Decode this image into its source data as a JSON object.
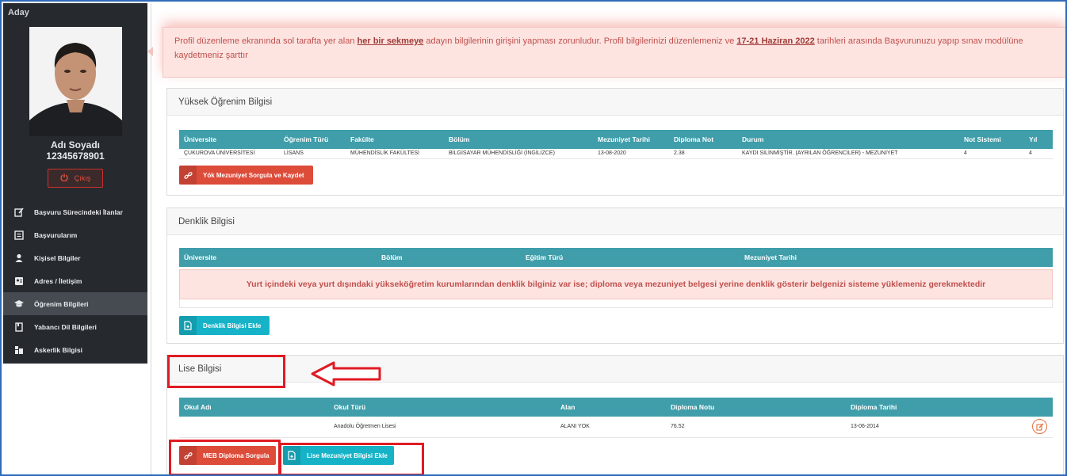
{
  "sidebar": {
    "title": "Aday",
    "name": "Adı Soyadı",
    "id_number": "12345678901",
    "logout_label": "Çıkış",
    "menu": [
      {
        "label": "Başvuru Sürecindeki İlanlar",
        "icon": "edit-icon"
      },
      {
        "label": "Başvurularım",
        "icon": "list-box-icon"
      },
      {
        "label": "Kişisel Bilgiler",
        "icon": "user-icon"
      },
      {
        "label": "Adres / İletişim",
        "icon": "address-card-icon"
      },
      {
        "label": "Öğrenim Bilgileri",
        "icon": "graduation-cap-icon"
      },
      {
        "label": "Yabancı Dil Bilgileri",
        "icon": "book-icon"
      },
      {
        "label": "Askerlik Bilgisi",
        "icon": "military-icon"
      }
    ],
    "active_index": 4
  },
  "alert": {
    "text_1": "Profil düzenleme ekranında sol tarafta yer alan ",
    "bold_1": "her bir sekmeye",
    "text_2": " adayın bilgilerinin girişini yapması zorunludur.  Profil bilgilerinizi düzenlemeniz ve ",
    "bold_2": "17-21 Haziran 2022",
    "text_3": " tarihleri arasında Başvurunuzu yapıp sınav modülüne kaydetmeniz şarttır"
  },
  "higher_education": {
    "title": "Yüksek Öğrenim Bilgisi",
    "headers": [
      "Üniversite",
      "Öğrenim Türü",
      "Fakülte",
      "Bölüm",
      "Mezuniyet Tarihi",
      "Diploma Not",
      "Durum",
      "Not Sistemi",
      "Yıl"
    ],
    "row": [
      "ÇUKUROVA ÜNİVERSİTESİ",
      "LİSANS",
      "MÜHENDİSLİK FAKÜLTESİ",
      "BİLGİSAYAR MÜHENDİSLİĞİ (İNGİLİZCE)",
      "13-08-2020",
      "2.38",
      "KAYDI SİLİNMİŞTİR. (AYRILAN ÖĞRENCİLER) - MEZUNİYET",
      "4",
      "4"
    ],
    "button_label": "Yök Mezuniyet Sorgula ve Kaydet"
  },
  "equivalence": {
    "title": "Denklik Bilgisi",
    "headers": [
      "Üniversite",
      "Bölüm",
      "Eğitim Türü",
      "Mezuniyet Tarihi"
    ],
    "notice": "Yurt içindeki veya yurt dışındaki yükseköğretim kurumlarından denklik bilginiz var ise; diploma veya mezuniyet belgesi yerine denklik gösterir belgenizi sisteme yüklemeniz gerekmektedir",
    "button_label": "Denklik Bilgisi Ekle"
  },
  "high_school": {
    "title": "Lise Bilgisi",
    "headers": [
      "Okul Adı",
      "Okul Türü",
      "Alan",
      "Diploma Notu",
      "Diploma Tarihi"
    ],
    "row": [
      "",
      "Anadolu Öğretmen Lisesi",
      "ALANI YOK",
      "76.52",
      "13-06-2014"
    ],
    "meb_button_label": "MEB Diploma Sorgula",
    "add_button_label": "Lise Mezuniyet Bilgisi Ekle"
  },
  "colors": {
    "table_header": "#3f9eaa",
    "danger": "#dd4b39",
    "info": "#16b3c8",
    "highlight": "#e01b24"
  }
}
